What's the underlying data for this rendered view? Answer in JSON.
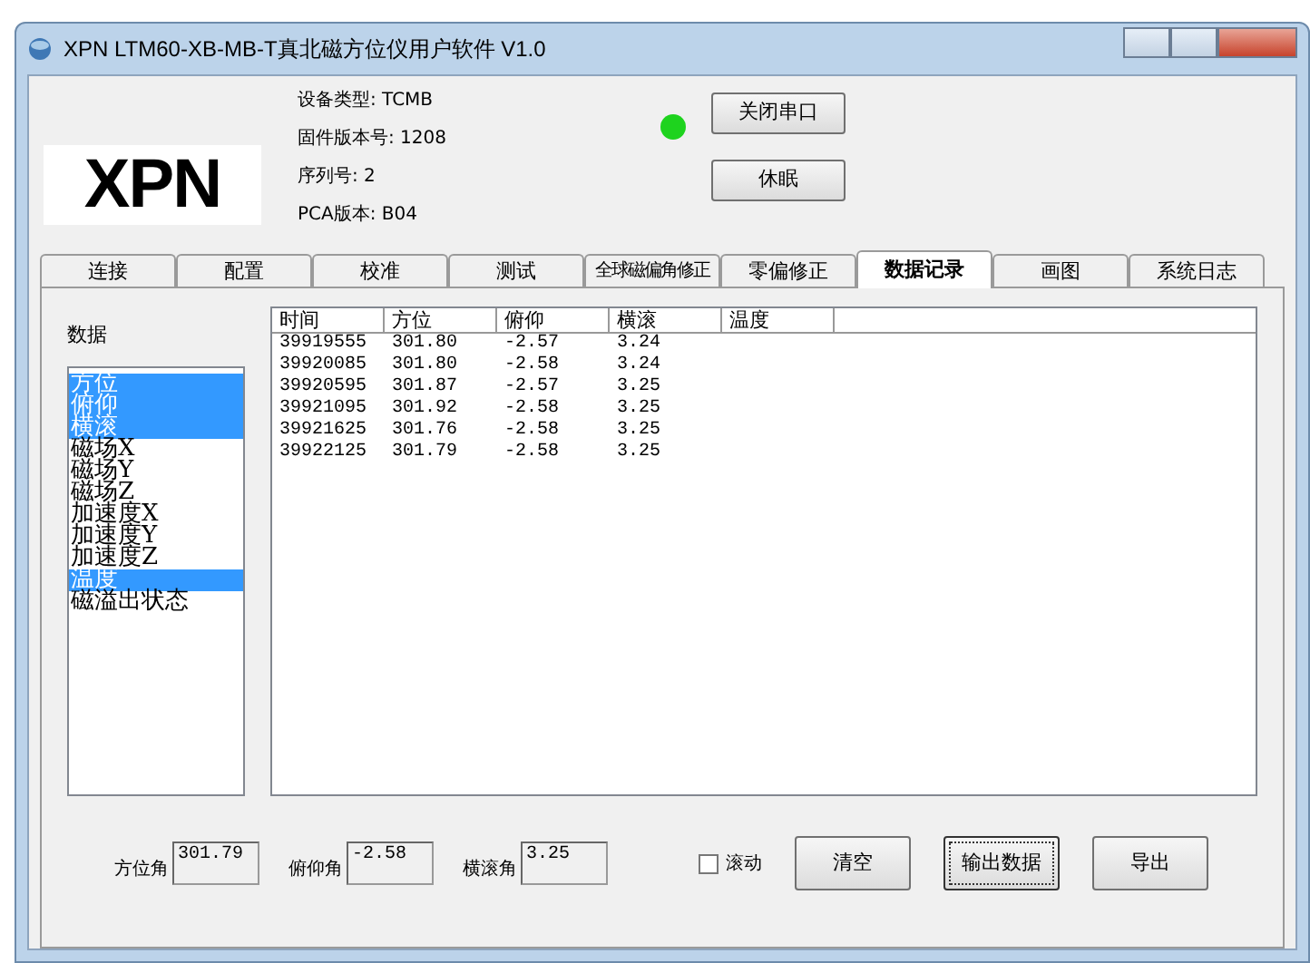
{
  "window": {
    "title": "XPN LTM60-XB-MB-T真北磁方位仪用户软件 V1.0"
  },
  "logo": {
    "text": "XPN"
  },
  "device_info": [
    "设备类型: TCMB",
    "固件版本号: 1208",
    "序列号: 2",
    "PCA版本: B04"
  ],
  "port_status": {
    "connected": true
  },
  "top_buttons": [
    "关闭串口",
    "休眠"
  ],
  "tabs": [
    {
      "label": "连接",
      "selected": false
    },
    {
      "label": "配置",
      "selected": false
    },
    {
      "label": "校准",
      "selected": false
    },
    {
      "label": "测试",
      "selected": false
    },
    {
      "label": "全球磁偏角修正",
      "selected": false
    },
    {
      "label": "零偏修正",
      "selected": false
    },
    {
      "label": "数据记录",
      "selected": true
    },
    {
      "label": "画图",
      "selected": false
    },
    {
      "label": "系统日志",
      "selected": false
    }
  ],
  "data_label": "数据",
  "data_list": [
    {
      "label": "方位",
      "selected": true
    },
    {
      "label": "俯仰",
      "selected": true
    },
    {
      "label": "横滚",
      "selected": true
    },
    {
      "label": "磁场X",
      "selected": false
    },
    {
      "label": "磁场Y",
      "selected": false
    },
    {
      "label": "磁场Z",
      "selected": false
    },
    {
      "label": "加速度X",
      "selected": false
    },
    {
      "label": "加速度Y",
      "selected": false
    },
    {
      "label": "加速度Z",
      "selected": false
    },
    {
      "label": "温度",
      "selected": true
    },
    {
      "label": "磁溢出状态",
      "selected": false
    }
  ],
  "table": {
    "columns": [
      "时间",
      "方位",
      "俯仰",
      "横滚",
      "温度"
    ],
    "rows": [
      [
        "39919555",
        "301.80",
        "-2.57",
        "3.24",
        ""
      ],
      [
        "39920085",
        "301.80",
        "-2.58",
        "3.24",
        ""
      ],
      [
        "39920595",
        "301.87",
        "-2.57",
        "3.25",
        ""
      ],
      [
        "39921095",
        "301.92",
        "-2.58",
        "3.25",
        ""
      ],
      [
        "39921625",
        "301.76",
        "-2.58",
        "3.25",
        ""
      ],
      [
        "39922125",
        "301.79",
        "-2.58",
        "3.25",
        ""
      ]
    ]
  },
  "readouts": [
    {
      "label": "方位角",
      "value": "301.79"
    },
    {
      "label": "俯仰角",
      "value": "-2.58"
    },
    {
      "label": "横滚角",
      "value": "3.25"
    }
  ],
  "scroll_checkbox": {
    "label": "滚动",
    "checked": false
  },
  "bottom_buttons": [
    {
      "label": "清空",
      "focused": false
    },
    {
      "label": "输出数据",
      "focused": true
    },
    {
      "label": "导出",
      "focused": false
    }
  ]
}
